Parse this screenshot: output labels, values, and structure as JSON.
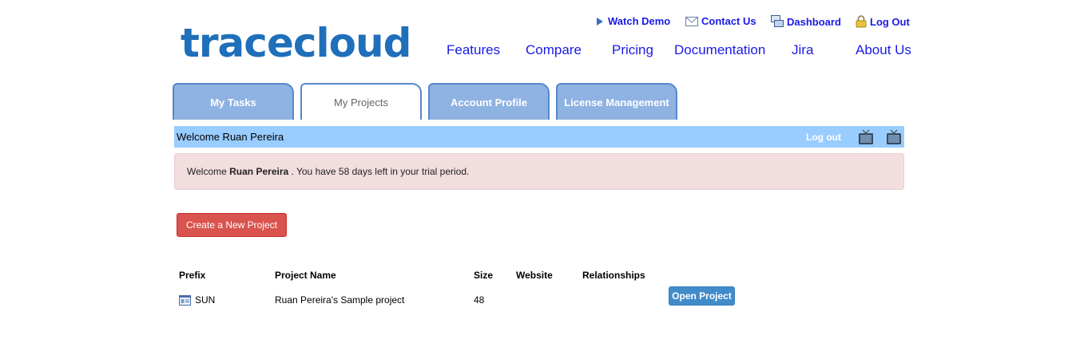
{
  "header": {
    "logo": "tracecloud",
    "utility": {
      "watch_demo": "Watch Demo",
      "contact_us": "Contact Us",
      "dashboard": "Dashboard",
      "log_out": "Log Out"
    },
    "nav": [
      "Features",
      "Compare",
      "Pricing",
      "Documentation",
      "Jira",
      "About Us"
    ]
  },
  "tabs": [
    {
      "label": "My Tasks",
      "active": false
    },
    {
      "label": "My Projects",
      "active": true
    },
    {
      "label": "Account Profile",
      "active": false
    },
    {
      "label": "License Management",
      "active": false
    }
  ],
  "welcome_bar": {
    "text": "Welcome Ruan Pereira",
    "logout": "Log out"
  },
  "alert": {
    "prefix": "Welcome",
    "name": "Ruan Pereira",
    "suffix": ". You have 58 days left in your trial period."
  },
  "create_button": "Create a New Project",
  "table": {
    "headers": [
      "Prefix",
      "Project Name",
      "Size",
      "Website",
      "Relationships"
    ],
    "rows": [
      {
        "prefix": "SUN",
        "name": "Ruan Pereira's Sample project",
        "size": "48",
        "website": "",
        "relationships": "",
        "action": "Open Project"
      }
    ]
  },
  "colors": {
    "brand": "#1f6fba",
    "link": "#1a1ae6",
    "tab": "#8eb2e2",
    "welcome_bar": "#99ccff",
    "danger": "#d9534f",
    "primary": "#428bca"
  }
}
